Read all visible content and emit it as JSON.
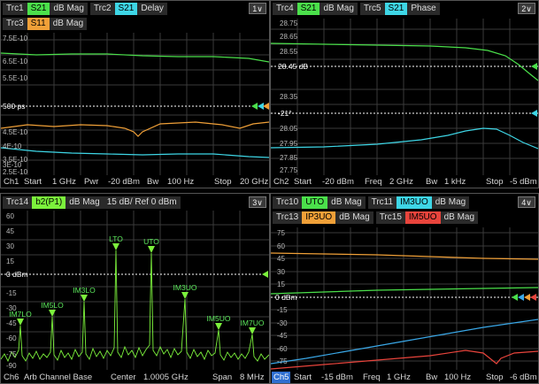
{
  "colors": {
    "green": "#4be04b",
    "cyan": "#3ed6e6",
    "orange": "#f0a038",
    "lime": "#7cf23c",
    "red": "#e8443c",
    "blue": "#3aa8e8",
    "gray": "#b8b8b8"
  },
  "win1": {
    "menu_btn": "1∨",
    "traces": [
      {
        "name": "Trc1",
        "ch": "S21",
        "fmt": "dB Mag",
        "color": "#4be04b"
      },
      {
        "name": "Trc2",
        "ch": "S21",
        "fmt": "Delay",
        "color": "#3ed6e6"
      },
      {
        "name": "Trc3",
        "ch": "S11",
        "fmt": "dB Mag",
        "color": "#f0a038"
      }
    ],
    "ylabels": [
      "7.5E-10",
      "6.5E-10",
      "5.5E-10",
      "500 ps",
      "4.5E-10",
      "4E-10",
      "3.5E-10",
      "3E-10",
      "2.5E-10"
    ],
    "ref_label": "500 ps",
    "status": {
      "ch": "Ch1",
      "start": "Start",
      "start_val": "1 GHz",
      "pwr": "Pwr",
      "pwr_val": "-20 dBm",
      "bw": "Bw",
      "bw_val": "100 Hz",
      "stop": "Stop",
      "stop_val": "20 GHz"
    }
  },
  "win2": {
    "menu_btn": "2∨",
    "traces": [
      {
        "name": "Trc4",
        "ch": "S21",
        "fmt": "dB Mag",
        "color": "#4be04b"
      },
      {
        "name": "Trc5",
        "ch": "S21",
        "fmt": "Phase",
        "color": "#3ed6e6"
      }
    ],
    "ylabels": [
      "28.75",
      "28.65",
      "28.55",
      "28.45 dB",
      "28.35",
      "-21°",
      "28.05",
      "27.95",
      "27.85",
      "27.75"
    ],
    "status": {
      "ch": "Ch2",
      "start": "Start",
      "start_val": "-20 dBm",
      "freq": "Freq",
      "freq_val": "2 GHz",
      "bw": "Bw",
      "bw_val": "1 kHz",
      "stop": "Stop",
      "stop_val": "-5 dBm"
    }
  },
  "win3": {
    "menu_btn": "3∨",
    "trace": {
      "name": "Trc14",
      "ch": "b2(P1)",
      "fmt": "dB Mag",
      "scale": "15 dB/ Ref 0 dBm",
      "color": "#7cf23c"
    },
    "ylabels": [
      "60",
      "45",
      "30",
      "15",
      "0 dBm",
      "-15",
      "-30",
      "-45",
      "-60",
      "-75",
      "-90"
    ],
    "markers": [
      "IM7LO",
      "IM5LO",
      "IM3LO",
      "LTO",
      "UTO",
      "IM3UO",
      "IM5UO",
      "IM7UO"
    ],
    "status": {
      "ch": "Ch6",
      "mode": "Arb Channel Base",
      "center": "Center",
      "center_val": "1.0005 GHz",
      "span": "Span",
      "span_val": "8 MHz"
    }
  },
  "win4": {
    "menu_btn": "4∨",
    "traces": [
      {
        "name": "Trc10",
        "ch": "UTO",
        "fmt": "dB Mag",
        "color": "#4be04b"
      },
      {
        "name": "Trc11",
        "ch": "IM3UO",
        "fmt": "dB Mag",
        "color": "#3ed6e6"
      },
      {
        "name": "Trc13",
        "ch": "IP3UO",
        "fmt": "dB Mag",
        "color": "#f0a038"
      },
      {
        "name": "Trc15",
        "ch": "IM5UO",
        "fmt": "dB Mag",
        "color": "#e8443c"
      }
    ],
    "ylabels": [
      "75",
      "60",
      "45",
      "30",
      "15",
      "0 dBm",
      "-15",
      "-30",
      "-45",
      "-60",
      "-75"
    ],
    "status": {
      "ch": "Ch5",
      "start": "Start",
      "start_val": "-15 dBm",
      "freq": "Freq",
      "freq_val": "1 GHz",
      "bw": "Bw",
      "bw_val": "100 Hz",
      "stop": "Stop",
      "stop_val": "-6 dBm"
    }
  }
}
